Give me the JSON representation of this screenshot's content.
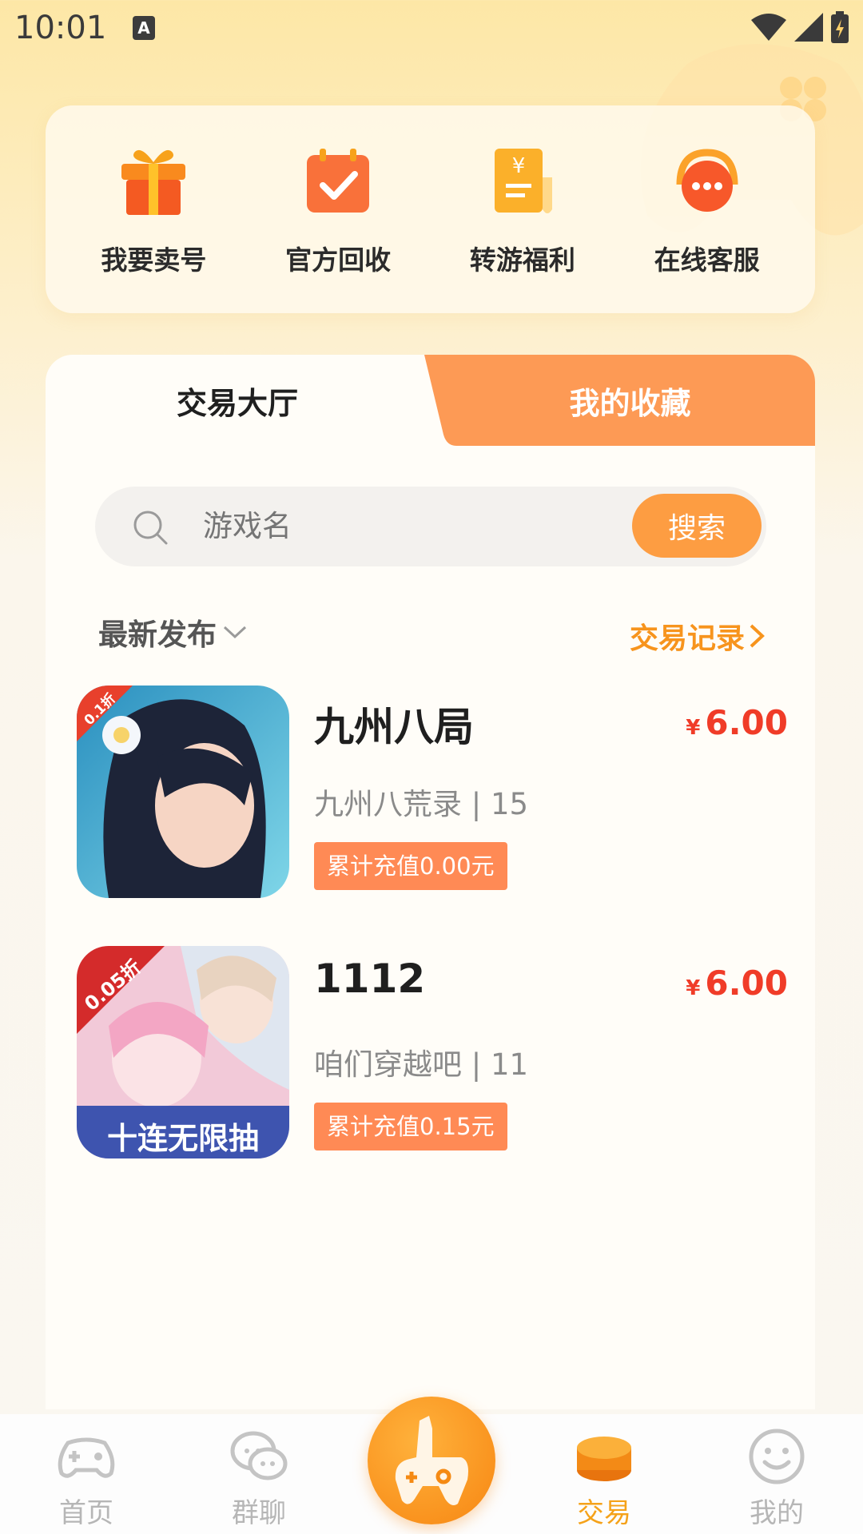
{
  "status_bar": {
    "time": "10:01",
    "indicator": "A"
  },
  "quick_actions": [
    {
      "label": "我要卖号",
      "icon": "gift-icon"
    },
    {
      "label": "官方回收",
      "icon": "calendar-check-icon"
    },
    {
      "label": "转游福利",
      "icon": "receipt-yen-icon"
    },
    {
      "label": "在线客服",
      "icon": "headset-chat-icon"
    }
  ],
  "tabs": {
    "hall": "交易大厅",
    "favorites": "我的收藏"
  },
  "search": {
    "placeholder": "游戏名",
    "button": "搜索"
  },
  "filter": {
    "sort_label": "最新发布",
    "trade_record": "交易记录"
  },
  "listings": [
    {
      "name": "九州八局",
      "currency": "¥",
      "price": "6.00",
      "server": "九州八荒录 | 15",
      "badge": "累计充值0.00元",
      "discount_tag": "0.1折"
    },
    {
      "name": "1112",
      "currency": "¥",
      "price": "6.00",
      "server": "咱们穿越吧 | 11",
      "badge": "累计充值0.15元",
      "discount_tag": "0.05折",
      "banner_text": "十连无限抽"
    }
  ],
  "bottom_nav": [
    {
      "label": "首页",
      "icon": "gamepad-icon",
      "active": false
    },
    {
      "label": "群聊",
      "icon": "chat-bubbles-icon",
      "active": false
    },
    {
      "label": "交易",
      "icon": "coins-icon",
      "active": true
    },
    {
      "label": "我的",
      "icon": "smiley-icon",
      "active": false
    }
  ],
  "colors": {
    "accent": "#fd9d42",
    "price": "#f03c28",
    "trade_record": "#f7941d",
    "nav_active": "#f5a21a"
  }
}
